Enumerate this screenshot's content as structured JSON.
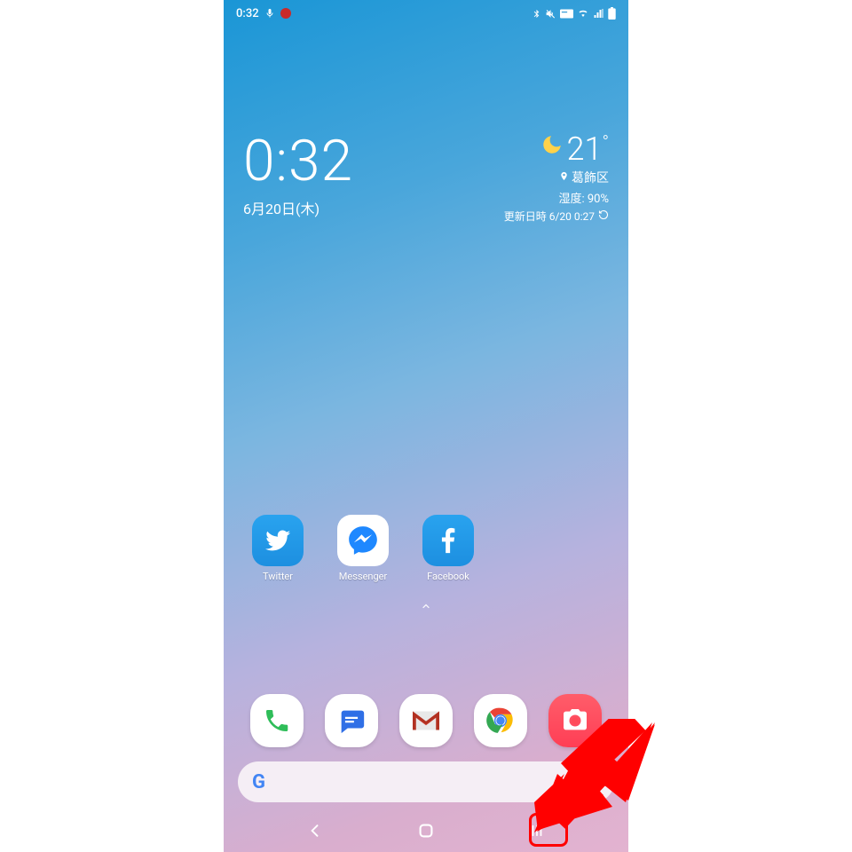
{
  "status_bar": {
    "time": "0:32",
    "icons_left": [
      "mic-icon",
      "record-dot-icon"
    ],
    "icons_right": [
      "bluetooth-icon",
      "mute-icon",
      "card-icon",
      "wifi-icon",
      "signal-icon",
      "battery-icon"
    ]
  },
  "clock_widget": {
    "time": "0:32",
    "date": "6月20日(木)"
  },
  "weather_widget": {
    "icon": "moon-icon",
    "temperature": "21",
    "unit": "°",
    "location": "葛飾区",
    "humidity_label": "湿度: 90%",
    "update_label": "更新日時 6/20 0:27"
  },
  "home_apps": [
    {
      "name": "twitter",
      "label": "Twitter"
    },
    {
      "name": "messenger",
      "label": "Messenger"
    },
    {
      "name": "facebook",
      "label": "Facebook"
    }
  ],
  "dock_apps": [
    {
      "name": "phone"
    },
    {
      "name": "messages"
    },
    {
      "name": "gmail"
    },
    {
      "name": "chrome"
    },
    {
      "name": "camera"
    }
  ],
  "search": {
    "provider": "Google"
  },
  "nav": {
    "back": "back",
    "home": "home",
    "recents": "recents"
  },
  "annotation": {
    "highlight_target": "recents-button",
    "arrow_color": "#ff0000"
  }
}
